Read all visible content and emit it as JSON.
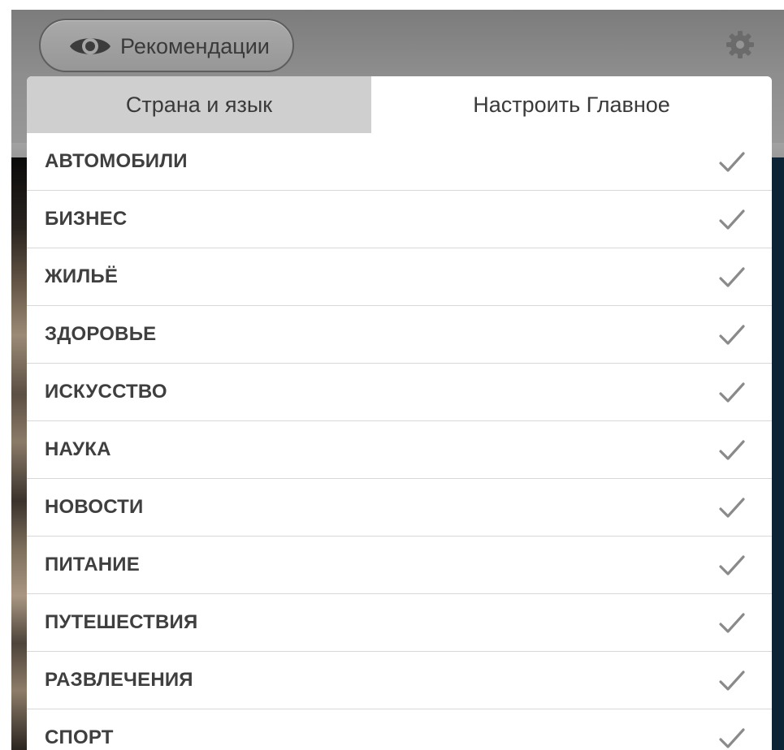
{
  "header": {
    "recommendations_label": "Рекомендации",
    "icons": {
      "recommendations": "eye-icon",
      "settings": "gear-icon"
    }
  },
  "tabs": [
    {
      "label": "Страна и язык",
      "active": false
    },
    {
      "label": "Настроить Главное",
      "active": true
    }
  ],
  "topics": [
    {
      "label": "АВТОМОБИЛИ",
      "checked": true
    },
    {
      "label": "БИЗНЕС",
      "checked": true
    },
    {
      "label": "ЖИЛЬЁ",
      "checked": true
    },
    {
      "label": "ЗДОРОВЬЕ",
      "checked": true
    },
    {
      "label": "ИСКУССТВО",
      "checked": true
    },
    {
      "label": "НАУКА",
      "checked": true
    },
    {
      "label": "НОВОСТИ",
      "checked": true
    },
    {
      "label": "ПИТАНИЕ",
      "checked": true
    },
    {
      "label": "ПУТЕШЕСТВИЯ",
      "checked": true
    },
    {
      "label": "РАЗВЛЕЧЕНИЯ",
      "checked": true
    },
    {
      "label": "СПОРТ",
      "checked": true
    }
  ],
  "colors": {
    "header_bg": "#8e8e8e",
    "inactive_tab_bg": "#cfcfcf",
    "active_tab_bg": "#ffffff",
    "row_text": "#3f3f3f",
    "check": "#8a8a8a",
    "divider": "#d8d8d8"
  }
}
